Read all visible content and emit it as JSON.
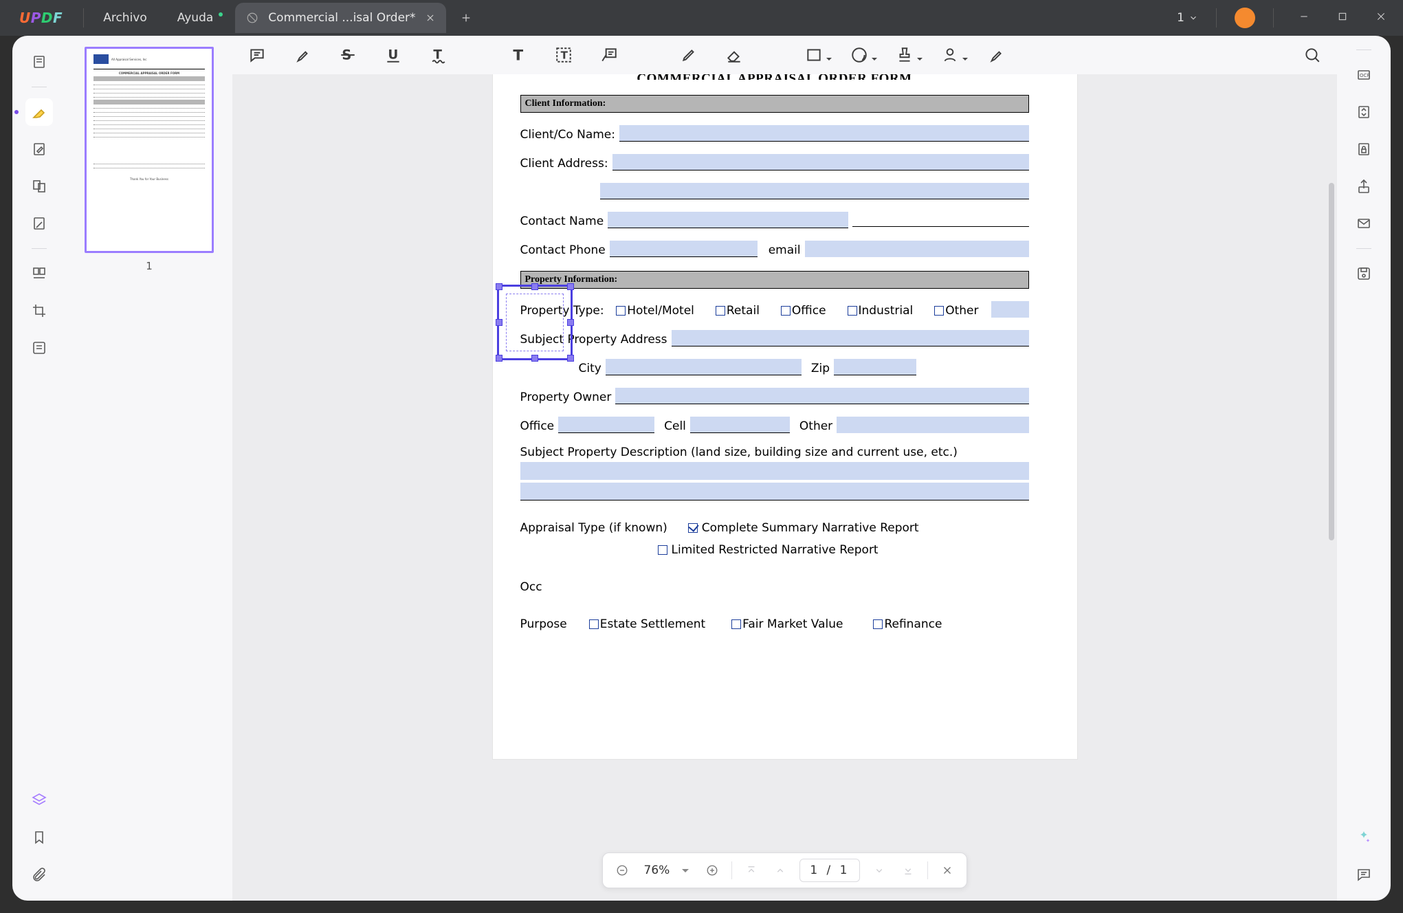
{
  "titlebar": {
    "menu_file": "Archivo",
    "menu_help": "Ayuda",
    "tab_title": "Commercial ...isal Order*",
    "zoom_number": "1",
    "avatar_initial": ""
  },
  "thumb": {
    "page_no": "1"
  },
  "doc": {
    "title_cut": "COMMERCIAL APPRAISAL ORDER FORM",
    "section_client": "Client Information:",
    "client_name_lbl": "Client/Co Name:",
    "client_addr_lbl": "Client Address:",
    "contact_name_lbl": "Contact Name",
    "contact_phone_lbl": "Contact Phone",
    "email_lbl": "email",
    "section_property": "Property Information:",
    "prop_type_lbl": "Property Type:",
    "opts": {
      "hotel": "Hotel/Motel",
      "retail": "Retail",
      "office": "Office",
      "industrial": "Industrial",
      "other": "Other"
    },
    "subj_addr_lbl": "Subject Property Address",
    "city_lbl": "City",
    "zip_lbl": "Zip",
    "owner_lbl": "Property Owner",
    "office_lbl": "Office",
    "cell_lbl": "Cell",
    "other_lbl": "Other",
    "subj_desc_lbl": "Subject Property Description (land size, building size and current use, etc.)",
    "appraisal_type_lbl": "Appraisal Type (if known)",
    "appraisal_opt1": "Complete Summary Narrative Report",
    "appraisal_opt2": "Limited Restricted Narrative Report",
    "occ_lbl": "Occ",
    "purpose_lbl": "Purpose",
    "purpose_opts": {
      "estate": "Estate Settlement",
      "fmv": "Fair Market Value",
      "refi": "Refinance"
    }
  },
  "pagectrl": {
    "zoom_pct": "76%",
    "page_of": "1  /  1"
  }
}
